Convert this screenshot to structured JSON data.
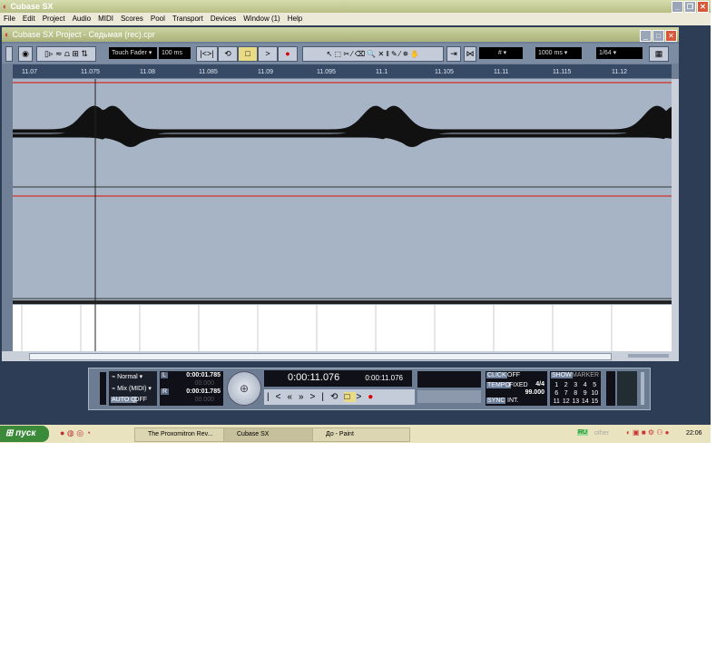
{
  "app": {
    "title": "Cubase SX"
  },
  "menu": [
    "File",
    "Edit",
    "Project",
    "Audio",
    "MIDI",
    "Scores",
    "Pool",
    "Transport",
    "Devices",
    "Window (1)",
    "Help"
  ],
  "project": {
    "title": "Cubase SX Project - Седьмая (rec).cpr",
    "toolbar": {
      "automation_mode": "Touch Fader",
      "preroll": "100 ms",
      "grid_label": "#",
      "quantize_time": "1000 ms",
      "quantize": "1/64"
    },
    "ruler": [
      "11.07",
      "11.075",
      "11.08",
      "11.085",
      "11.09",
      "11.095",
      "11.1",
      "11.105",
      "11.11",
      "11.115",
      "11.12"
    ]
  },
  "transport": {
    "mode": "Normal",
    "cycle_mode": "Mix (MIDI)",
    "auto_label": "AUTO Q",
    "auto_value": "OFF",
    "left_locator": "0:00:01.785",
    "right_locator": "0:00:01.785",
    "left_sub": "00.000",
    "right_sub": "00.000",
    "position": "0:00:11.076",
    "position2": "0:00:11.076",
    "click_label": "CLICK",
    "click_value": "OFF",
    "tempo_label": "TEMPO",
    "tempo_mode": "FIXED",
    "signature": "4/4",
    "tempo": "99.000",
    "sync_label": "SYNC",
    "sync_value": "INT.",
    "show_label": "SHOW",
    "marker_label": "MARKER",
    "markers": [
      "1",
      "2",
      "3",
      "4",
      "5",
      "6",
      "7",
      "8",
      "9",
      "10",
      "11",
      "12",
      "13",
      "14",
      "15"
    ],
    "L": "L",
    "R": "R"
  },
  "taskbar": {
    "start": "пуск",
    "tasks": [
      "The Proxomitron Rev...",
      "Cubase SX",
      "До - Paint"
    ],
    "lang": "RU",
    "tray_text": "other",
    "clock": "22:06"
  }
}
